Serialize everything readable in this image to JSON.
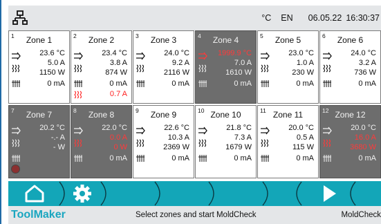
{
  "header": {
    "unit": "°C",
    "language": "EN",
    "date": "06.05.22",
    "time": "16:30:37"
  },
  "zones": [
    {
      "num": "1",
      "name": "Zone 1",
      "temp": "23.6 °C",
      "current": "5.0 A",
      "power": "1150 W",
      "leak": "0 mA",
      "gray": false
    },
    {
      "num": "2",
      "name": "Zone 2",
      "temp": "23.4 °C",
      "current": "3.8 A",
      "power": "874 W",
      "leak": "0 mA",
      "extra": "0.7 A",
      "gray": false
    },
    {
      "num": "3",
      "name": "Zone 3",
      "temp": "24.0 °C",
      "current": "9.2 A",
      "power": "2116 W",
      "leak": "0 mA",
      "gray": false
    },
    {
      "num": "4",
      "name": "Zone 4",
      "temp": "1999.9 °C",
      "current": "7.0 A",
      "power": "1610 W",
      "leak": "0 mA",
      "gray": true,
      "temp_alarm": true
    },
    {
      "num": "5",
      "name": "Zone 5",
      "temp": "23.0 °C",
      "current": "1.0 A",
      "power": "230 W",
      "leak": "0 mA",
      "gray": false
    },
    {
      "num": "6",
      "name": "Zone 6",
      "temp": "24.0 °C",
      "current": "3.2 A",
      "power": "736 W",
      "leak": "0 mA",
      "gray": false
    },
    {
      "num": "7",
      "name": "Zone 7",
      "temp": "20.2 °C",
      "current": "-.- A",
      "power": "- W",
      "leak": "",
      "gray": true
    },
    {
      "num": "8",
      "name": "Zone 8",
      "temp": "22.0 °C",
      "current": "0.0 A",
      "power": "0 W",
      "leak": "0 mA",
      "gray": true,
      "current_alarm": true
    },
    {
      "num": "9",
      "name": "Zone 9",
      "temp": "22.6 °C",
      "current": "10.3 A",
      "power": "2369 W",
      "leak": "0 mA",
      "gray": false
    },
    {
      "num": "10",
      "name": "Zone 10",
      "temp": "21.8 °C",
      "current": "7.3 A",
      "power": "1679 W",
      "leak": "0 mA",
      "gray": false
    },
    {
      "num": "11",
      "name": "Zone 11",
      "temp": "20.0 °C",
      "current": "0.5 A",
      "power": "115 W",
      "leak": "0 mA",
      "gray": false
    },
    {
      "num": "12",
      "name": "Zone 12",
      "temp": "20.0 °C",
      "current": "16.0 A",
      "power": "3680 W",
      "leak": "0 mA",
      "gray": true,
      "current_alarm": true
    }
  ],
  "nav": {
    "home_icon": "home-icon",
    "settings_icon": "gear-icon",
    "next_icon": "play-icon"
  },
  "status": {
    "brand": "ToolMaker",
    "message": "Select zones and start MoldCheck",
    "mode": "MoldCheck"
  },
  "colors": {
    "accent": "#13a6b8",
    "alarm": "#ff2020",
    "tile_gray": "#6d6d6d"
  }
}
